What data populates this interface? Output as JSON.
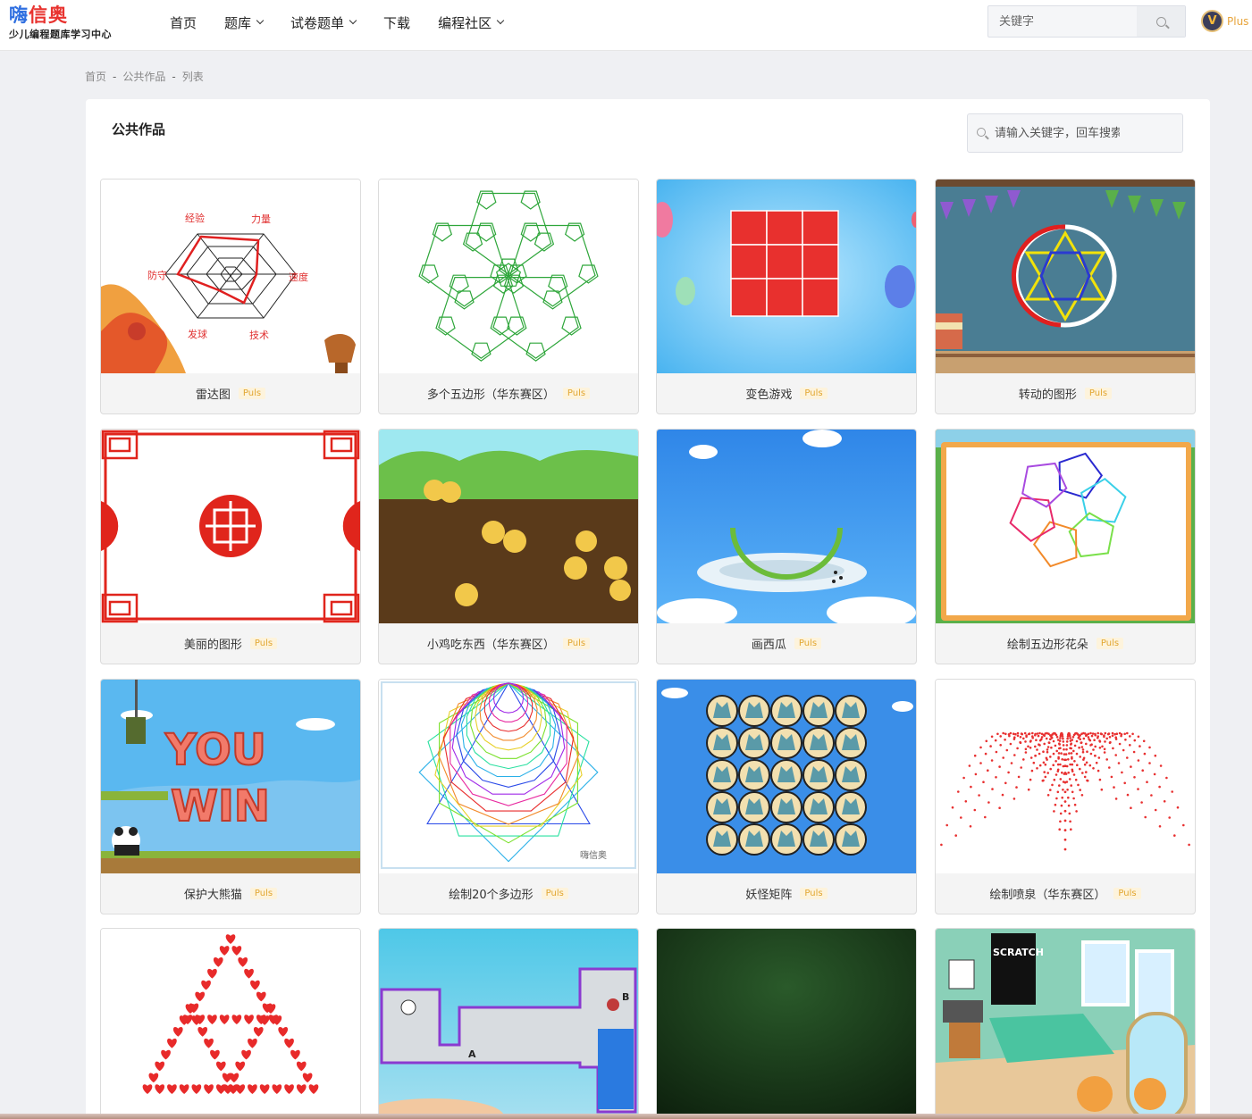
{
  "header": {
    "logo_title_a": "嗨",
    "logo_title_b": "信奥",
    "logo_subtitle": "少儿编程题库学习中心",
    "nav": [
      {
        "label": "首页"
      },
      {
        "label": "题库"
      },
      {
        "label": "试卷题单"
      },
      {
        "label": "下载"
      },
      {
        "label": "编程社区"
      }
    ],
    "search_placeholder": "关键字",
    "plus_label": "Plus"
  },
  "breadcrumb": [
    "首页",
    "公共作品",
    "列表"
  ],
  "panel": {
    "title": "公共作品",
    "search_placeholder": "请输入关键字，回车搜索"
  },
  "tag_label": "Puls",
  "radar_labels": {
    "top_left": "经验",
    "top_right": "力量",
    "left": "防守",
    "right": "速度",
    "bottom_left": "发球",
    "bottom_right": "技术"
  },
  "cards": [
    {
      "title": "雷达图",
      "icon": "radar-chart-thumbnail"
    },
    {
      "title": "多个五边形（华东赛区）",
      "icon": "pentagons-thumbnail"
    },
    {
      "title": "变色游戏",
      "icon": "color-grid-thumbnail"
    },
    {
      "title": "转动的图形",
      "icon": "rotating-star-thumbnail"
    },
    {
      "title": "美丽的图形",
      "icon": "chinese-pattern-thumbnail"
    },
    {
      "title": "小鸡吃东西（华东赛区）",
      "icon": "chicks-thumbnail"
    },
    {
      "title": "画西瓜",
      "icon": "watermelon-thumbnail"
    },
    {
      "title": "绘制五边形花朵",
      "icon": "pentagon-flower-thumbnail"
    },
    {
      "title": "保护大熊猫",
      "icon": "you-win-thumbnail"
    },
    {
      "title": "绘制20个多边形",
      "icon": "polygons-thumbnail"
    },
    {
      "title": "妖怪矩阵",
      "icon": "monster-matrix-thumbnail"
    },
    {
      "title": "绘制喷泉（华东赛区）",
      "icon": "fountain-thumbnail"
    },
    {
      "title": "",
      "icon": "hearts-thumbnail"
    },
    {
      "title": "",
      "icon": "maze-thumbnail"
    },
    {
      "title": "",
      "icon": "dark-green-thumbnail"
    },
    {
      "title": "",
      "icon": "bedroom-thumbnail"
    }
  ],
  "maze_labels": {
    "a": "A",
    "b": "B"
  },
  "scratch_sign": "SCRATCH",
  "you_win": [
    "YOU",
    "WIN"
  ],
  "watermark": "嗨信奥",
  "colors": {
    "brand_blue": "#2f6fe0",
    "brand_red": "#e8332f",
    "tag": "#e2a630"
  }
}
